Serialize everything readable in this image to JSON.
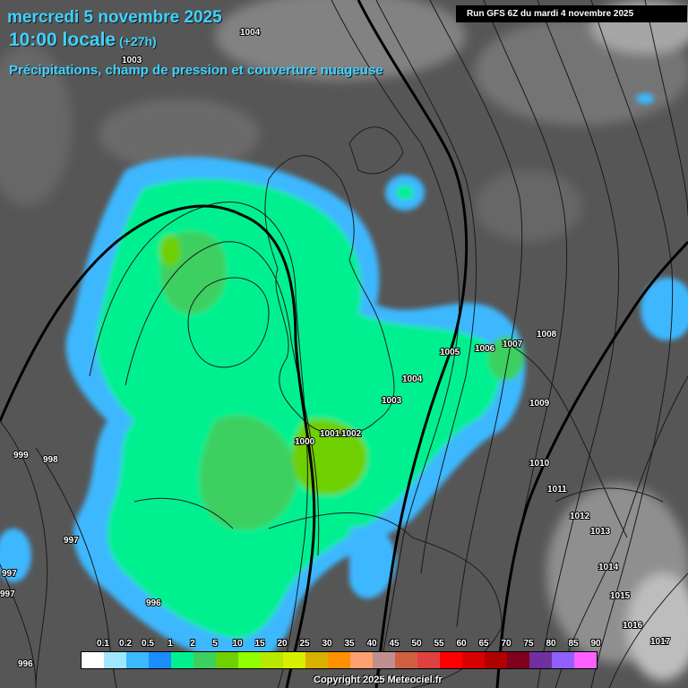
{
  "header": {
    "date": "mercredi 5 novembre 2025",
    "time": "10:00 locale",
    "offset": "(+27h)",
    "subtitle": "Précipitations, champ de pression et couverture nuageuse"
  },
  "run_info": "Run GFS 6Z du mardi 4 novembre 2025",
  "isobar_labels": [
    "1004",
    "1003",
    "999",
    "998",
    "997",
    "997",
    "997",
    "996",
    "996",
    "1000",
    "1001",
    "1002",
    "1003",
    "1004",
    "1005",
    "1006",
    "1007",
    "1008",
    "1009",
    "1010",
    "1011",
    "1012",
    "1013",
    "1014",
    "1015",
    "1016",
    "1017"
  ],
  "legend": {
    "labels": [
      "0.1",
      "0.2",
      "0.5",
      "1",
      "2",
      "5",
      "10",
      "15",
      "20",
      "25",
      "30",
      "35",
      "40",
      "45",
      "50",
      "55",
      "60",
      "65",
      "70",
      "75",
      "80",
      "85",
      "90"
    ],
    "colors": [
      "#ffffff",
      "#9fe6ff",
      "#3cb8ff",
      "#1d8cff",
      "#00f090",
      "#3cd060",
      "#6ed000",
      "#90ff00",
      "#b8e800",
      "#d8f000",
      "#d8b000",
      "#ff9000",
      "#ffa070",
      "#c09090",
      "#d06040",
      "#e04040",
      "#ff0000",
      "#d80000",
      "#b00000",
      "#800020",
      "#7030a0",
      "#9060ff",
      "#ff60ff"
    ]
  },
  "copyright": "Copyright 2025 Meteociel.fr"
}
